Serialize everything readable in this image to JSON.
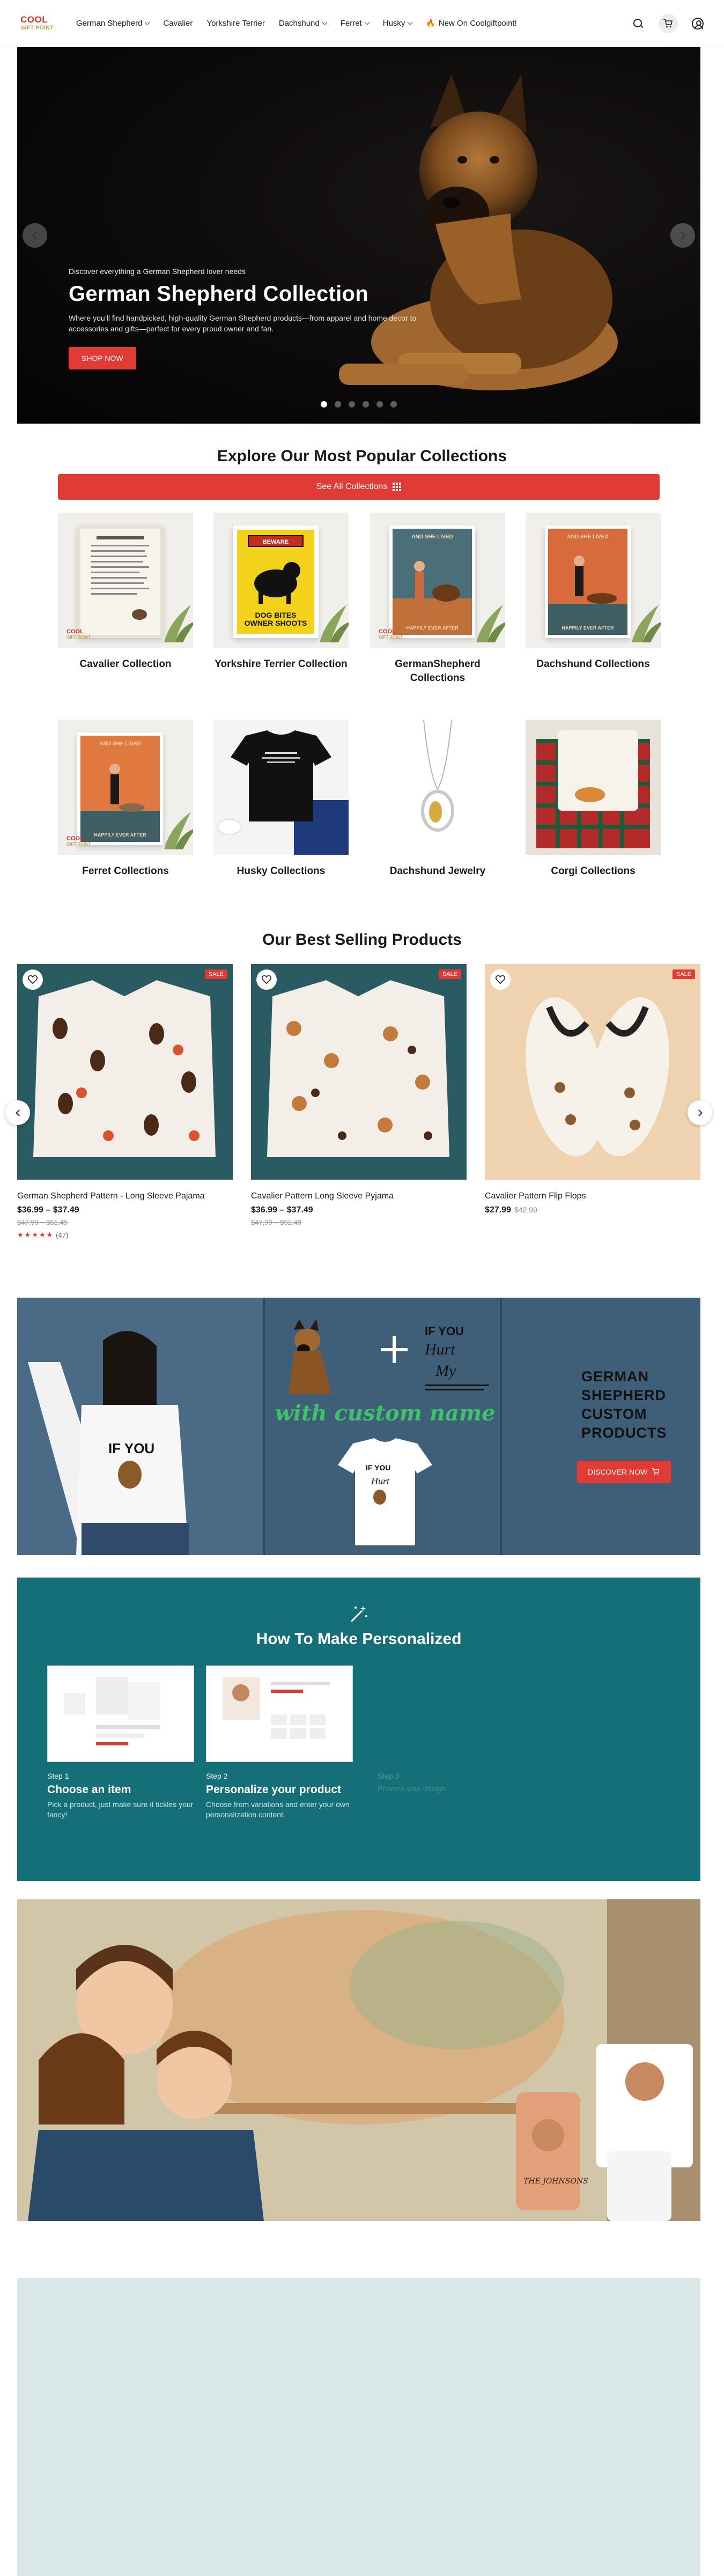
{
  "header": {
    "logo_line1": "COOL",
    "logo_line2": "GIFT POINT",
    "nav": [
      {
        "label": "German Shepherd",
        "has_menu": true
      },
      {
        "label": "Cavalier",
        "has_menu": false
      },
      {
        "label": "Yorkshire Terrier",
        "has_menu": false
      },
      {
        "label": "Dachshund",
        "has_menu": true
      },
      {
        "label": "Ferret",
        "has_menu": true
      },
      {
        "label": "Husky",
        "has_menu": true
      },
      {
        "label": "New On Coolgiftpoint!",
        "has_menu": false
      }
    ],
    "fire_glyph": "🔥",
    "icons": [
      "search-icon",
      "cart-icon",
      "account-icon"
    ]
  },
  "hero": {
    "eyebrow": "Discover everything a German Shepherd lover needs",
    "title": "German Shepherd Collection",
    "subtitle": "Where you’ll find handpicked, high-quality German Shepherd products—from apparel and home decor to accessories and gifts—perfect for every proud owner and fan.",
    "button": "SHOP NOW",
    "slide_count": 6,
    "active_slide": 1
  },
  "collections": {
    "title": "Explore Our Most Popular Collections",
    "see_all": "See All Collections",
    "items": [
      {
        "name": "Cavalier Collection"
      },
      {
        "name": "Yorkshire Terrier Collection"
      },
      {
        "name": "GermanShepherd Collections"
      },
      {
        "name": "Dachshund Collections"
      },
      {
        "name": "Ferret Collections"
      },
      {
        "name": "Husky Collections"
      },
      {
        "name": "Dachshund Jewelry"
      },
      {
        "name": "Corgi Collections"
      }
    ],
    "poster_texts": {
      "beware": "BEWARE",
      "dog_bites": "DOG BITES",
      "owner_shoots": "OWNER SHOOTS",
      "and_she_lived": "AND SHE LIVED",
      "happily_ever_after": "HAPPILY EVER AFTER"
    }
  },
  "best_sellers": {
    "title": "Our Best Selling Products",
    "products": [
      {
        "name": "German Shepherd Pattern - Long Sleeve Pajama",
        "price": "$36.99 – $37.49",
        "old_price": "$47.99 – $51.49",
        "badge": "SALE",
        "rating_count": "(47)",
        "stars": 5
      },
      {
        "name": "Cavalier Pattern Long Sleeve Pyjama",
        "price": "$36.99 – $37.49",
        "old_price": "$47.99 – $51.49",
        "badge": "SALE"
      },
      {
        "name": "Cavalier Pattern Flip Flops",
        "price": "$27.99",
        "old_price": "$42.99",
        "badge": "SALE"
      }
    ]
  },
  "custom_banner": {
    "shirt_text": "IF YOU Hurt My Dog",
    "custom_name": "with custom name",
    "title_line1": "GERMAN",
    "title_line2": "SHEPHERD",
    "title_line3": "CUSTOM",
    "title_line4": "PRODUCTS",
    "button": "DISCOVER NOW"
  },
  "howto": {
    "title": "How To Make Personalized",
    "steps": [
      {
        "num": "Step 1",
        "title": "Choose an item",
        "desc": "Pick a product, just make sure it tickles your fancy!"
      },
      {
        "num": "Step 2",
        "title": "Personalize your product",
        "desc": "Choose from variations and enter your own personalization content."
      },
      {
        "num": "Step 3",
        "title": "",
        "desc": "Preview your design"
      }
    ]
  },
  "family_banner": {
    "mug_name": "THE JOHNSONS"
  },
  "colors": {
    "accent": "#e03b35",
    "hero_bg": "#0b0909",
    "banner_bg": "#3f5e78",
    "howto_bg": "#156f78",
    "bottom_bg": "#d9e7e8"
  }
}
